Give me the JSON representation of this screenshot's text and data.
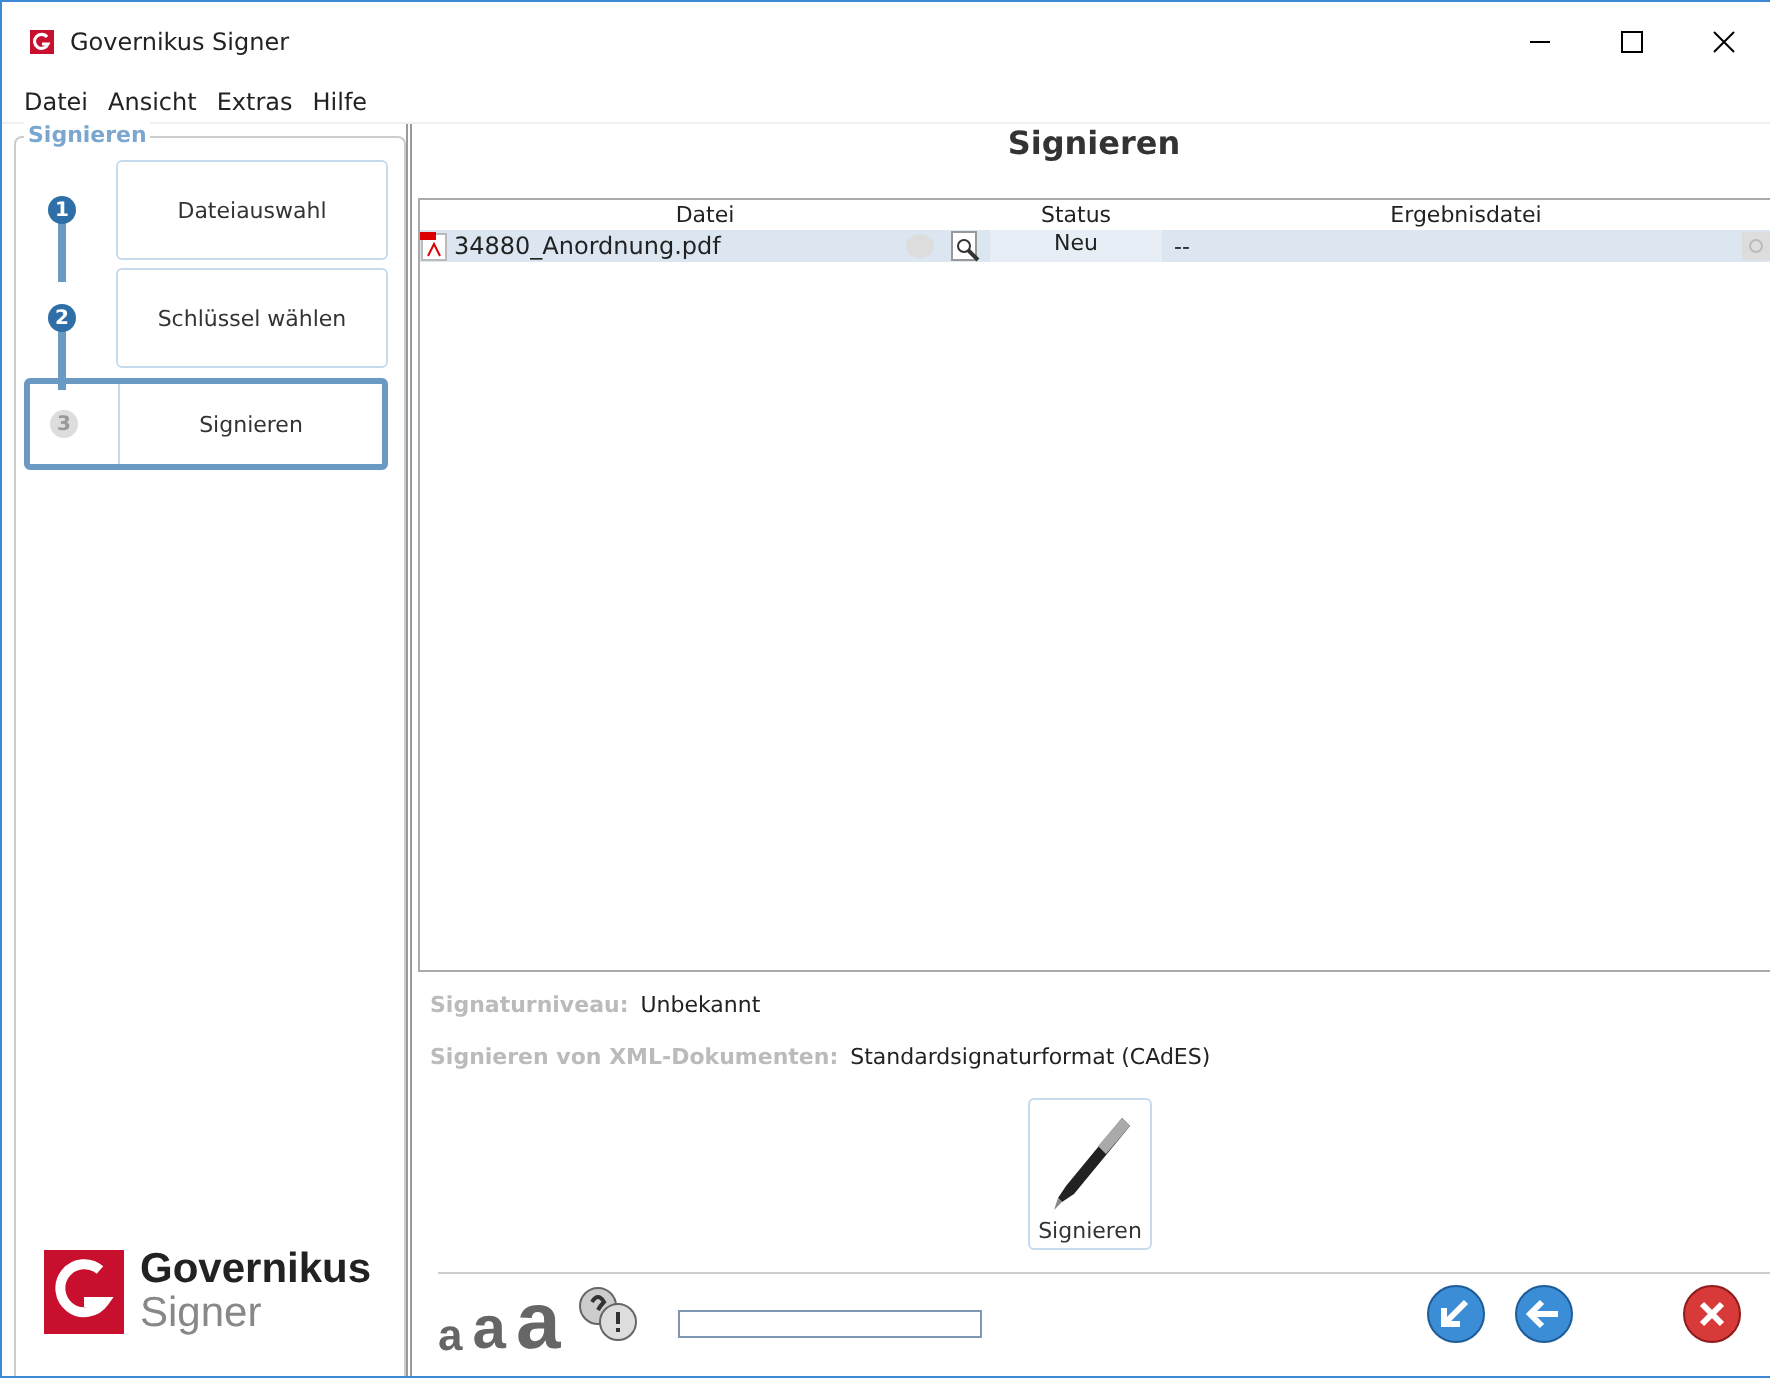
{
  "window": {
    "title": "Governikus Signer"
  },
  "menu": [
    "Datei",
    "Ansicht",
    "Extras",
    "Hilfe"
  ],
  "steps_panel": {
    "title": "Signieren",
    "steps": [
      {
        "number": "1",
        "label": "Dateiauswahl",
        "selected": false
      },
      {
        "number": "2",
        "label": "Schlüssel wählen",
        "selected": false
      },
      {
        "number": "3",
        "label": "Signieren",
        "selected": true
      }
    ]
  },
  "logo": {
    "name": "Governikus",
    "product": "Signer"
  },
  "heading": "Signieren",
  "table": {
    "columns": [
      "Datei",
      "Status",
      "Ergebnisdatei"
    ],
    "rows": [
      {
        "file": "34880_Anordnung.pdf",
        "status": "Neu",
        "result": "--",
        "selected": true
      }
    ]
  },
  "info": [
    {
      "label": "Signaturniveau:",
      "value": "Unbekannt"
    },
    {
      "label": "Signieren von XML-Dokumenten:",
      "value": "Standardsignaturformat (CAdES)"
    }
  ],
  "sign_button": "Signieren",
  "toolbar": {
    "font_sizes": [
      "a",
      "a",
      "a"
    ],
    "progress": {
      "level": 0
    }
  }
}
